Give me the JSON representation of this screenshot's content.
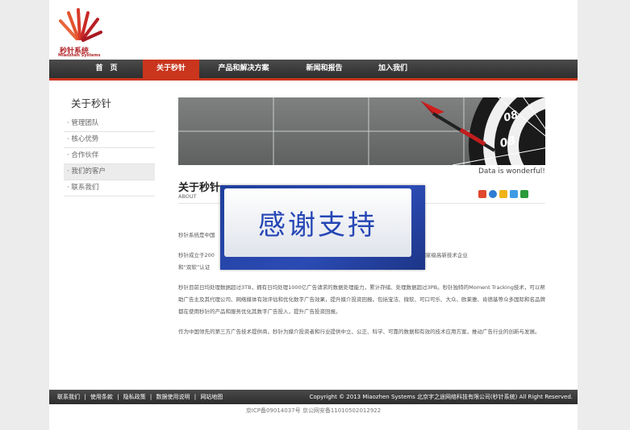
{
  "brand": {
    "cn": "秒针系统",
    "en": "Miaozhen Systems"
  },
  "nav": [
    {
      "label": "首　页",
      "active": false
    },
    {
      "label": "关于秒针",
      "active": true
    },
    {
      "label": "产品和解决方案",
      "active": false
    },
    {
      "label": "新闻和报告",
      "active": false
    },
    {
      "label": "加入我们",
      "active": false
    }
  ],
  "sidebar": {
    "title": "关于秒针",
    "items": [
      "· 管理团队",
      "· 核心优势",
      "· 合作伙伴",
      "· 我们的客户",
      "· 联系我们"
    ]
  },
  "banner": {
    "tagline": "Data is wonderful!"
  },
  "article": {
    "title": "关于秒针",
    "subtitle": "ABOUT",
    "p1": "秒针系统是中国",
    "p2": "秒针成立于200",
    "p2_tail": "名全职员工，是国家级高新技术企业",
    "p2b": "和“双软”认证",
    "p3": "秒针目前日均处理数据超过3TB，拥有日均处理1000亿广告请求的数据处理能力，累计存储、处理数据超过3PB。秒针独特的Moment Tracking技术，可以帮助广告主及其代理公司、网络媒体有效评估和优化数字广告效果，提升媒介投资回报。包括宝洁、微软、可口可乐、大众、欧莱雅、肯德基等众多国际和名品牌都在使用秒针的产品和服务优化其数字广告投入，提升广告投资回报。",
    "p4": "作为中国领先的第三方广告技术提供商，秒针为媒介投资者和行业提供中立、公正、科学、可靠的数据和有效的技术应用方案，推动广告行业的创新与发展。"
  },
  "overlay": {
    "text": "感谢支持"
  },
  "footer": {
    "links": [
      "联系我们",
      "|",
      "使用条款",
      "|",
      "隐私政策",
      "|",
      "数据使用说明",
      "|",
      "网站地图"
    ],
    "copyright": "Copyright © 2013 Miaozhen Systems 北京字之途网络科技有限公司(秒针系统) All Right Reserved.",
    "icp": "京ICP备09014037号 京公网安备11010502012922"
  }
}
